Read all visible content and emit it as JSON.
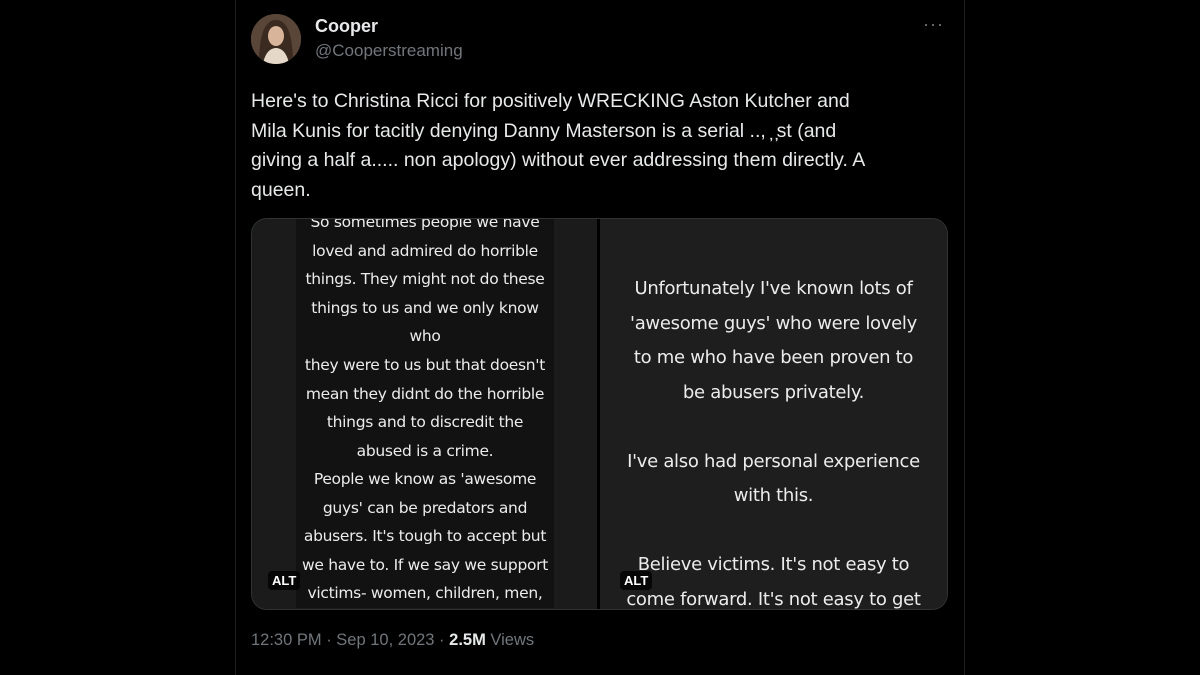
{
  "author": {
    "display_name": "Cooper",
    "handle": "@Cooperstreaming"
  },
  "more_icon": "···",
  "tweet": {
    "text": "Here's to Christina Ricci for positively WRECKING Aston Kutcher and\nMila Kunis for tacitly denying Danny Masterson is a serial .., ̦ ̦st (and\ngiving a half a..... non apology) without ever addressing them directly. A\nqueen."
  },
  "media": {
    "left_block_1": "So sometimes people we have\nloved and admired do horrible\nthings. They might not do these\nthings to us and we only know who\nthey were to us but that doesn't\nmean they didnt do the horrible\nthings and to discredit the\nabused is a crime.",
    "left_block_2": "People we know as 'awesome\nguys' can be predators and\nabusers. It's tough to accept but\nwe have to. If we say we support\nvictims- women, children, men,",
    "right_text": "Unfortunately I've known lots of\n'awesome guys' who were lovely\nto me who have been proven to\nbe abusers privately.\n\nI've also had personal experience\nwith this.\n\nBelieve victims. It's not easy to\ncome forward. It's not easy to get",
    "alt_label": "ALT"
  },
  "meta": {
    "time": "12:30 PM",
    "separator": " · ",
    "date": "Sep 10, 2023",
    "views_count": "2.5M",
    "views_label": " Views"
  },
  "colors": {
    "background": "#000000",
    "text_primary": "#e7e9ea",
    "text_secondary": "#71767b",
    "border": "#2f3336"
  }
}
